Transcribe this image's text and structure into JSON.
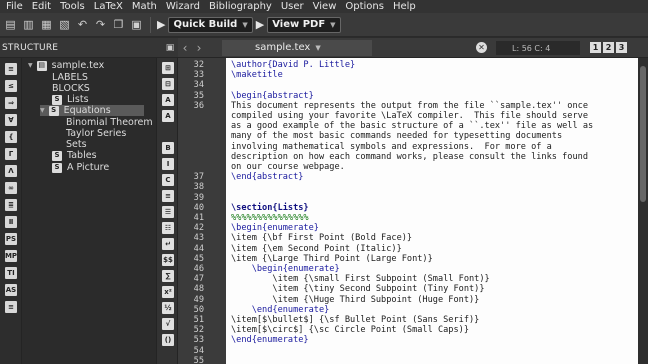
{
  "menu": [
    "File",
    "Edit",
    "Tools",
    "LaTeX",
    "Math",
    "Wizard",
    "Bibliography",
    "User",
    "View",
    "Options",
    "Help"
  ],
  "toolbar": {
    "build_label": "Quick Build",
    "view_label": "View PDF"
  },
  "structure": {
    "title": "STRUCTURE",
    "tree": [
      {
        "label": "sample.tex",
        "icon": "file-icon"
      },
      {
        "label": "LABELS"
      },
      {
        "label": "BLOCKS"
      },
      {
        "label": "Lists",
        "icon": "section-icon"
      },
      {
        "label": "Equations",
        "icon": "section-icon"
      },
      {
        "label": "Binomial Theorem"
      },
      {
        "label": "Taylor Series"
      },
      {
        "label": "Sets"
      },
      {
        "label": "Tables",
        "icon": "section-icon"
      },
      {
        "label": "A Picture",
        "icon": "section-icon"
      }
    ]
  },
  "editor": {
    "tab_label": "sample.tex",
    "cursor": "L: 56 C: 4",
    "view_buttons": [
      "1",
      "2",
      "3"
    ],
    "line_numbers": [
      "32",
      "33",
      "34",
      "35",
      "36",
      "",
      "",
      "",
      "",
      "",
      "",
      "37",
      "38",
      "39",
      "40",
      "41",
      "42",
      "43",
      "44",
      "45",
      "46",
      "47",
      "48",
      "49",
      "50",
      "51",
      "52",
      "53",
      "54",
      "55"
    ],
    "lines": [
      {
        "t": "\\author{David P. Little}",
        "c": "blue"
      },
      {
        "t": "\\maketitle",
        "c": "blue"
      },
      {
        "t": "",
        "c": ""
      },
      {
        "t": "\\begin{abstract}",
        "c": "blue"
      },
      {
        "t": "This document represents the output from the file ``sample.tex'' once",
        "c": ""
      },
      {
        "t": "compiled using your favorite \\LaTeX compiler.  This file should serve",
        "c": ""
      },
      {
        "t": "as a good example of the basic structure of a ``.tex'' file as well as",
        "c": ""
      },
      {
        "t": "many of the most basic commands needed for typesetting documents",
        "c": ""
      },
      {
        "t": "involving mathematical symbols and expressions.  For more of a",
        "c": ""
      },
      {
        "t": "description on how each command works, please consult the links found",
        "c": ""
      },
      {
        "t": "on our course webpage.",
        "c": ""
      },
      {
        "t": "\\end{abstract}",
        "c": "blue"
      },
      {
        "t": "",
        "c": ""
      },
      {
        "t": "",
        "c": ""
      },
      {
        "t": "\\section{Lists}",
        "c": "sect"
      },
      {
        "t": "%%%%%%%%%%%%%%%",
        "c": "pct"
      },
      {
        "t": "\\begin{enumerate}",
        "c": "blue"
      },
      {
        "t": "\\item {\\bf First Point (Bold Face)}",
        "c": ""
      },
      {
        "t": "\\item {\\em Second Point (Italic)}",
        "c": ""
      },
      {
        "t": "\\item {\\Large Third Point (Large Font)}",
        "c": ""
      },
      {
        "t": "    \\begin{enumerate}",
        "c": "blue"
      },
      {
        "t": "        \\item {\\small First Subpoint (Small Font)}",
        "c": ""
      },
      {
        "t": "        \\item {\\tiny Second Subpoint (Tiny Font)}",
        "c": ""
      },
      {
        "t": "        \\item {\\Huge Third Subpoint (Huge Font)}",
        "c": ""
      },
      {
        "t": "    \\end{enumerate}",
        "c": "blue"
      },
      {
        "t": "\\item[$\\bullet$] {\\sf Bullet Point (Sans Serif)}",
        "c": ""
      },
      {
        "t": "\\item[$\\circ$] {\\sc Circle Point (Small Caps)}",
        "c": ""
      },
      {
        "t": "\\end{enumerate}",
        "c": "blue"
      },
      {
        "t": "",
        "c": ""
      },
      {
        "t": "",
        "c": ""
      }
    ]
  }
}
